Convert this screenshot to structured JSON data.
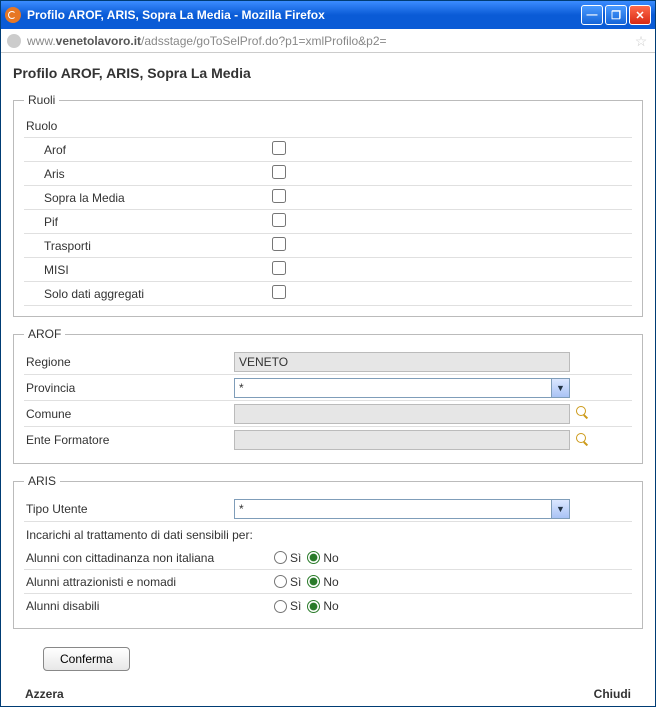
{
  "window": {
    "title": "Profilo AROF, ARIS, Sopra La Media - Mozilla Firefox"
  },
  "address": {
    "prefix": "www.",
    "host": "venetolavoro.it",
    "path": "/adsstage/goToSelProf.do?p1=xmlProfilo&p2="
  },
  "page": {
    "title": "Profilo AROF, ARIS, Sopra La Media"
  },
  "ruoli": {
    "legend": "Ruoli",
    "header": "Ruolo",
    "items": [
      {
        "label": "Arof"
      },
      {
        "label": "Aris"
      },
      {
        "label": "Sopra la Media"
      },
      {
        "label": "Pif"
      },
      {
        "label": "Trasporti"
      },
      {
        "label": "MISI"
      },
      {
        "label": "Solo dati aggregati"
      }
    ]
  },
  "arof": {
    "legend": "AROF",
    "regione_label": "Regione",
    "regione_value": "VENETO",
    "provincia_label": "Provincia",
    "provincia_value": "*",
    "comune_label": "Comune",
    "comune_value": "",
    "ente_label": "Ente Formatore",
    "ente_value": ""
  },
  "aris": {
    "legend": "ARIS",
    "tipo_label": "Tipo Utente",
    "tipo_value": "*",
    "incarichi_label": "Incarichi al trattamento di dati sensibili per:",
    "si_label": "Sì",
    "no_label": "No",
    "rows": [
      {
        "label": "Alunni con cittadinanza non italiana"
      },
      {
        "label": "Alunni attrazionisti e nomadi"
      },
      {
        "label": "Alunni disabili"
      }
    ]
  },
  "buttons": {
    "conferma": "Conferma",
    "azzera": "Azzera",
    "chiudi": "Chiudi"
  }
}
